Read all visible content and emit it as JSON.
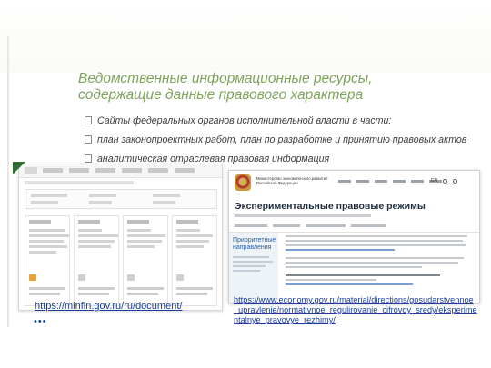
{
  "slide": {
    "title_line1": "Ведомственные информационные ресурсы,",
    "title_line2": "содержащие данные правового характера",
    "bullets": [
      "Сайты федеральных органов исполнительной власти в части:",
      "план законопроектных работ, план по разработке и принятию правовых актов",
      "аналитическая отраслевая правовая информация"
    ],
    "accent_color": "#7fa35a",
    "link_color": "#1a3f99"
  },
  "screenshot_right": {
    "ministry": "Министерство экономического развития Российской Федерации",
    "lang": "EN",
    "page_title": "Экспериментальные правовые режимы",
    "side_title": "Приоритетные направления"
  },
  "links": {
    "minfin": "https://minfin.gov.ru/ru/document/",
    "minfin_tail": "•••",
    "economy": "https://www.economy.gov.ru/material/directions/gosudarstvennoe_upravlenie/normativnoe_regulirovanie_cifrovoy_sredy/eksperimentalnye_pravovye_rezhimy/"
  }
}
